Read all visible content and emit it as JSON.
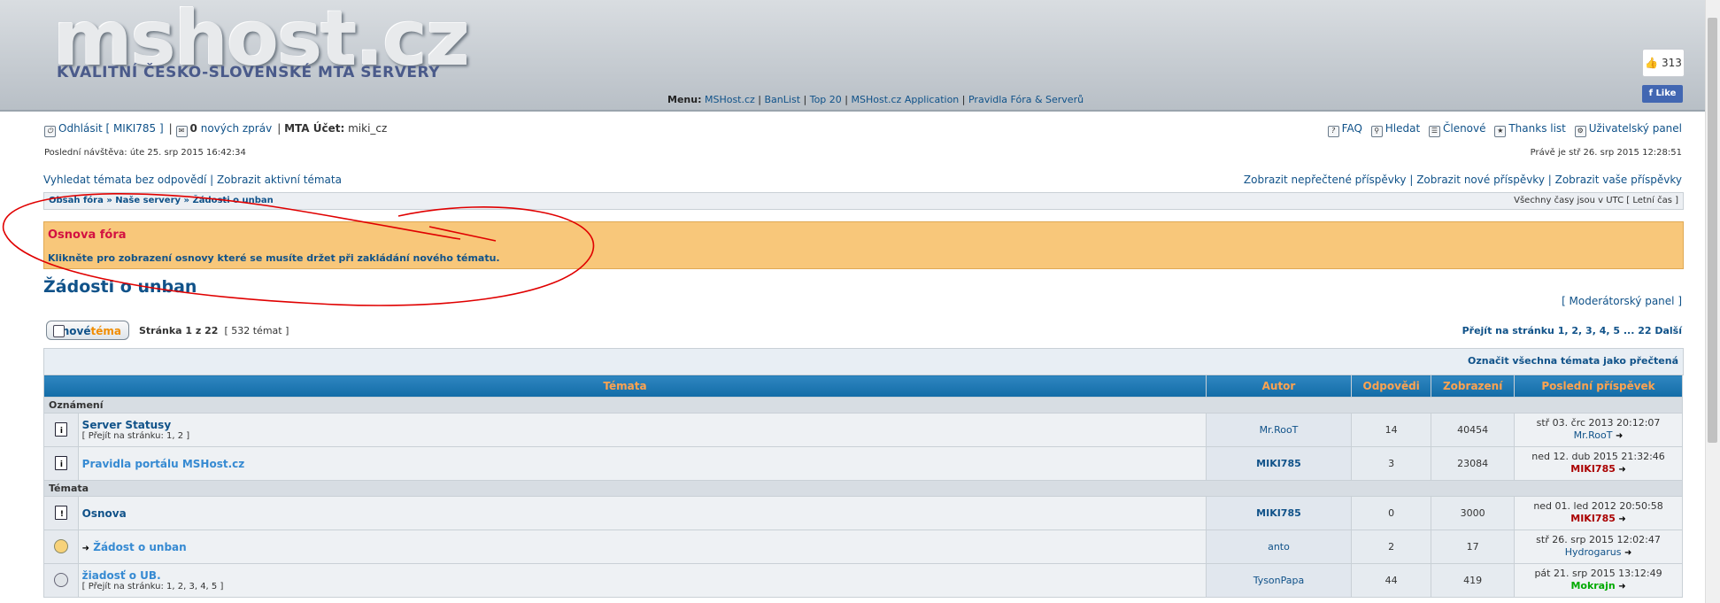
{
  "header": {
    "logo": "mshost.cz",
    "subtitle": "KVALITNÍ ČESKO-SLOVENSKÉ MTA SERVERY",
    "menu_label": "Menu:",
    "menu": [
      "MSHost.cz",
      "BanList",
      "Top 20",
      "MSHost.cz Application",
      "Pravidla Fóra & Serverů"
    ],
    "fb_count": "313",
    "fb_like": "Like"
  },
  "userbar": {
    "logout": "Odhlásit [ MIKI785 ]",
    "new_messages_count": "0",
    "new_messages_label": "nových zpráv",
    "mta_label": "MTA Účet:",
    "mta_account": "miki_cz",
    "faq": "FAQ",
    "search": "Hledat",
    "members": "Členové",
    "thanks": "Thanks list",
    "user_panel": "Uživatelský panel",
    "last_visit": "Poslední návštěva: úte 25. srp 2015 16:42:34",
    "now": "Právě je stř 26. srp 2015 12:28:51"
  },
  "quicklinks": {
    "unanswered": "Vyhledat témata bez odpovědí",
    "active": "Zobrazit aktivní témata",
    "unread": "Zobrazit nepřečtené příspěvky",
    "new": "Zobrazit nové příspěvky",
    "yours": "Zobrazit vaše příspěvky"
  },
  "breadcrumb": {
    "path": "Obsah fóra » Naše servery » Žádosti o unban",
    "timezone": "Všechny časy jsou v UTC [ Letní čas ]"
  },
  "notice": {
    "title": "Osnova fóra",
    "text": "Klikněte pro zobrazení osnovy které se musíte držet při zakládání nového tématu."
  },
  "forum": {
    "title": "Žádosti o unban",
    "mod_panel": "[ Moderátorský panel ]",
    "new_topic_a": "nové",
    "new_topic_b": "téma",
    "page_info": "Stránka 1 z 22",
    "topic_count": "[ 532 témat ]",
    "pagination": "Přejít na stránku 1, 2, 3, 4, 5 ... 22  Další",
    "mark_read": "Označit všechna témata jako přečtená"
  },
  "table": {
    "headers": [
      "Témata",
      "Autor",
      "Odpovědi",
      "Zobrazení",
      "Poslední příspěvek"
    ],
    "cat_announcements": "Oznámení",
    "cat_topics": "Témata",
    "rows": [
      {
        "title": "Server Statusy",
        "pages": "[ Přejít na stránku: 1, 2 ]",
        "author": "Mr.RooT",
        "replies": "14",
        "views": "40454",
        "last_date": "stř 03. črc 2013 20:12:07",
        "last_author": "Mr.RooT"
      },
      {
        "title": "Pravidla portálu MSHost.cz",
        "pages": "",
        "author": "MIKI785",
        "replies": "3",
        "views": "23084",
        "last_date": "ned 12. dub 2015 21:32:46",
        "last_author": "MIKI785"
      },
      {
        "title": "Osnova",
        "pages": "",
        "author": "MIKI785",
        "replies": "0",
        "views": "3000",
        "last_date": "ned 01. led 2012 20:50:58",
        "last_author": "MIKI785"
      },
      {
        "title": "Žádost o unban",
        "pages": "",
        "author": "anto",
        "replies": "2",
        "views": "17",
        "last_date": "stř 26. srp 2015 12:02:47",
        "last_author": "Hydrogarus"
      },
      {
        "title": "žiadosť o UB.",
        "pages": "[ Přejít na stránku: 1, 2, 3, 4, 5 ]",
        "author": "TysonPapa",
        "replies": "44",
        "views": "419",
        "last_date": "pát 21. srp 2015 13:12:49",
        "last_author": "Mokrajn"
      }
    ]
  },
  "colors": {
    "link": "#105289",
    "moderator": "#aa0000",
    "notice_bg": "#f8c77a",
    "header_th": "#126ca7",
    "annotation": "#e00000"
  }
}
